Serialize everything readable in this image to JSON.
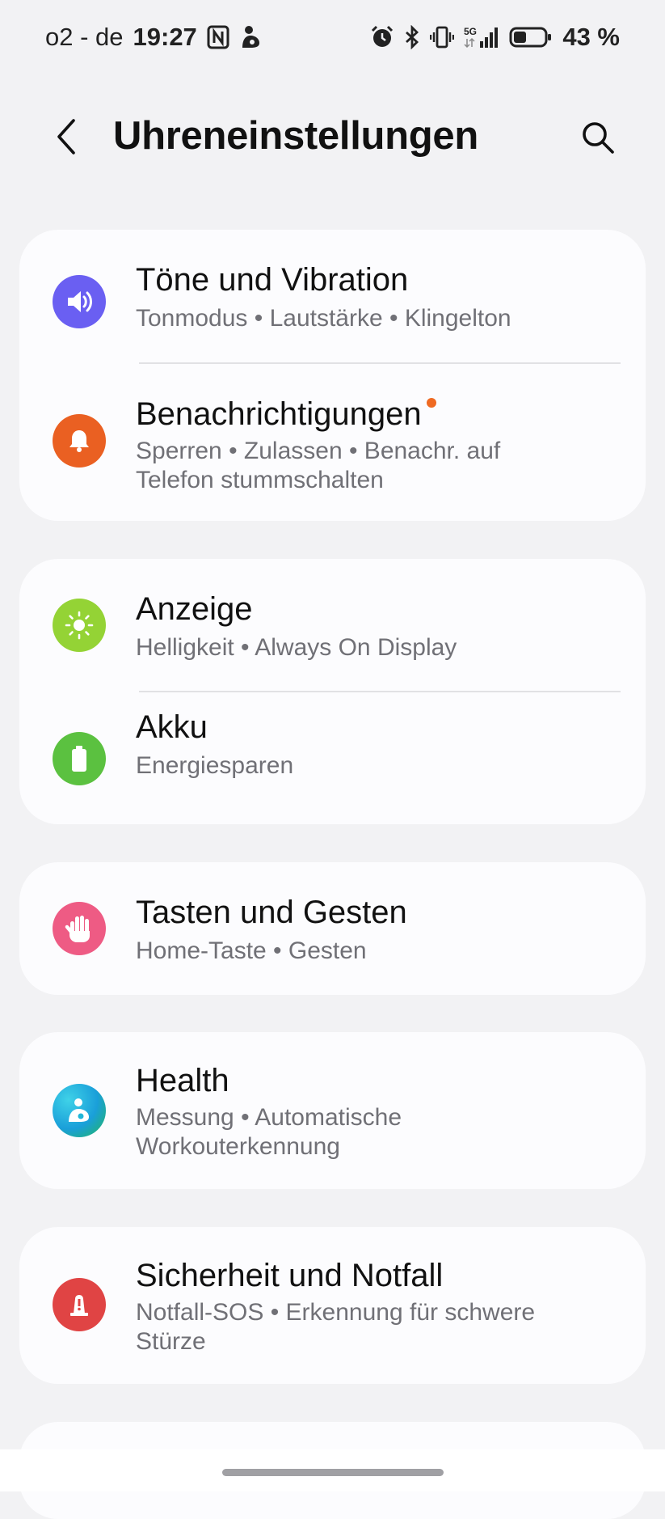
{
  "status_bar": {
    "carrier": "o2 - de",
    "time": "19:27",
    "network": "5G",
    "battery_percent": "43 %",
    "battery_level": 0.43,
    "icons": [
      "nfc-icon",
      "samsung-health-icon",
      "alarm-icon",
      "bluetooth-icon",
      "vibrate-icon",
      "signal-icon",
      "battery-icon"
    ]
  },
  "header": {
    "title": "Uhreneinstellungen",
    "back_icon": "chevron-left-icon",
    "search_icon": "search-icon"
  },
  "cards": [
    {
      "items": [
        {
          "title": "Töne und Vibration",
          "subtitle": "Tonmodus • Lautstärke • Klingelton",
          "icon": "sound-icon",
          "color": "#6a5ff2"
        },
        {
          "title": "Benachrichtigungen",
          "subtitle": "Sperren • Zulassen • Benachr. auf Telefon stummschalten",
          "icon": "bell-icon",
          "color": "#ea6022",
          "badge": true
        }
      ]
    },
    {
      "items": [
        {
          "title": "Anzeige",
          "subtitle": "Helligkeit • Always On Display",
          "icon": "brightness-icon",
          "color": "#94d335"
        },
        {
          "title": "Akku",
          "subtitle": "Energiesparen",
          "icon": "battery-icon",
          "color": "#5bc140"
        }
      ]
    },
    {
      "items": [
        {
          "title": "Tasten und Gesten",
          "subtitle": "Home-Taste • Gesten",
          "icon": "hand-icon",
          "color": "#ee5b84"
        }
      ]
    },
    {
      "items": [
        {
          "title": "Health",
          "subtitle": "Messung • Automatische Workouterkennung",
          "icon": "health-icon",
          "color": "#1fb5d8"
        }
      ]
    },
    {
      "items": [
        {
          "title": "Sicherheit und Notfall",
          "subtitle": "Notfall-SOS • Erkennung für schwere Stürze",
          "icon": "emergency-icon",
          "color": "#e04444"
        }
      ]
    }
  ]
}
